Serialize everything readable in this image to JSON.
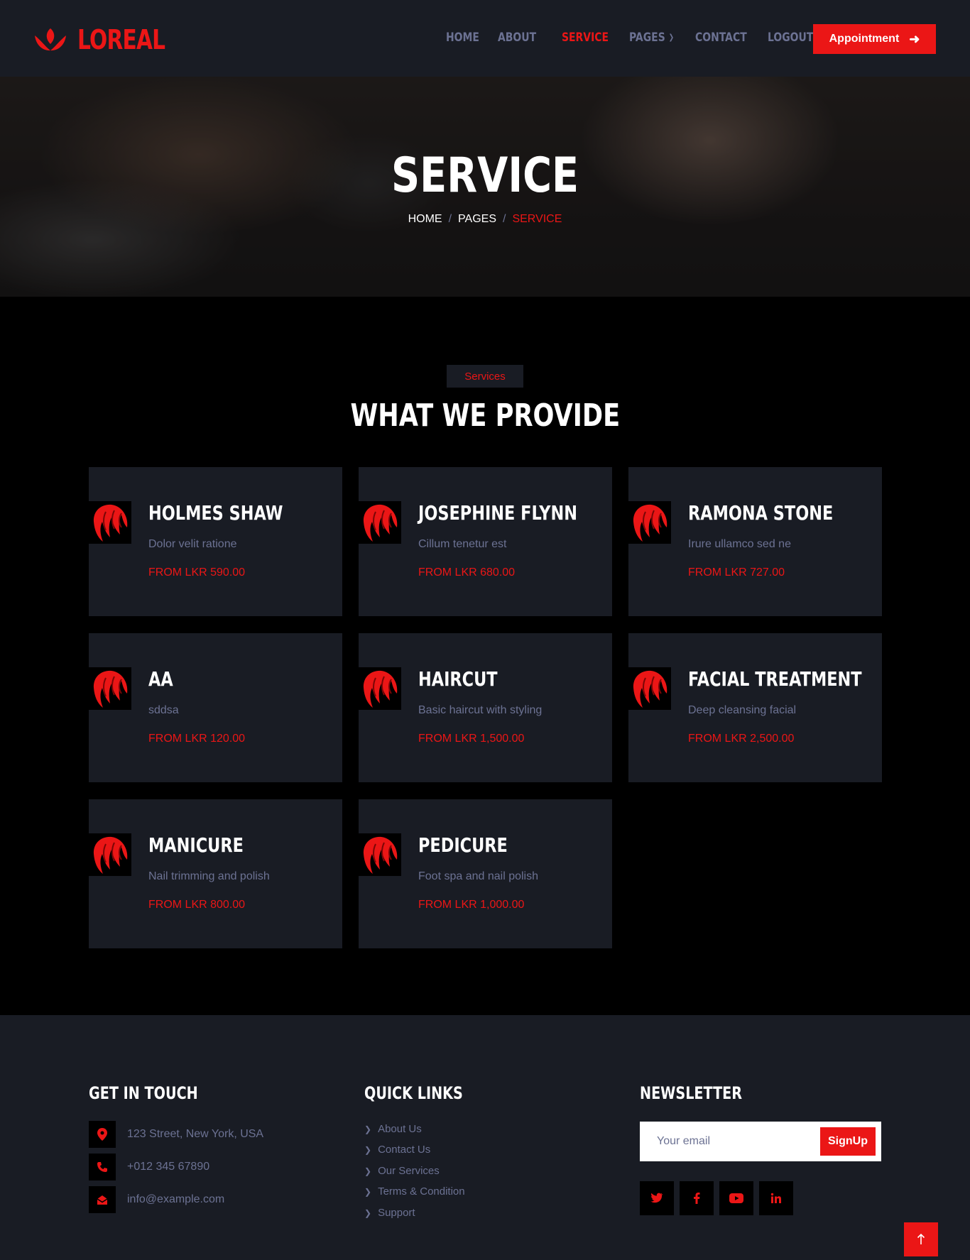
{
  "brand": {
    "name": "LOREAL",
    "accent": "#eb1616",
    "icon": "lotus-icon"
  },
  "nav": {
    "items": [
      {
        "label": "HOME",
        "active": false
      },
      {
        "label": "ABOUT",
        "active": false
      },
      {
        "label": "SERVICE",
        "active": true
      },
      {
        "label": "PAGES",
        "active": false,
        "dropdown": true
      },
      {
        "label": "CONTACT",
        "active": false
      },
      {
        "label": "LOGOUT",
        "active": false
      }
    ],
    "appointment_label": "Appointment"
  },
  "hero": {
    "title": "SERVICE",
    "breadcrumb": [
      "HOME",
      "PAGES",
      "SERVICE"
    ]
  },
  "section": {
    "tag": "Services",
    "title": "WHAT WE PROVIDE"
  },
  "services": [
    {
      "name": "HOLMES SHAW",
      "description": "Dolor velit ratione",
      "price": "FROM LKR 590.00"
    },
    {
      "name": "JOSEPHINE FLYNN",
      "description": "Cillum tenetur est",
      "price": "FROM LKR 680.00"
    },
    {
      "name": "RAMONA STONE",
      "description": "Irure ullamco sed ne",
      "price": "FROM LKR 727.00"
    },
    {
      "name": "AA",
      "description": "sddsa",
      "price": "FROM LKR 120.00"
    },
    {
      "name": "HAIRCUT",
      "description": "Basic haircut with styling",
      "price": "FROM LKR 1,500.00"
    },
    {
      "name": "FACIAL TREATMENT",
      "description": "Deep cleansing facial",
      "price": "FROM LKR 2,500.00"
    },
    {
      "name": "MANICURE",
      "description": "Nail trimming and polish",
      "price": "FROM LKR 800.00"
    },
    {
      "name": "PEDICURE",
      "description": "Foot spa and nail polish",
      "price": "FROM LKR 1,000.00"
    }
  ],
  "footer": {
    "contact": {
      "heading": "GET IN TOUCH",
      "address": "123 Street, New York, USA",
      "phone": "+012 345 67890",
      "email": "info@example.com"
    },
    "links": {
      "heading": "QUICK LINKS",
      "items": [
        "About Us",
        "Contact Us",
        "Our Services",
        "Terms & Condition",
        "Support"
      ]
    },
    "newsletter": {
      "heading": "NEWSLETTER",
      "placeholder": "Your email",
      "button": "SignUp"
    },
    "social": [
      "twitter-icon",
      "facebook-icon",
      "youtube-icon",
      "linkedin-icon"
    ]
  }
}
